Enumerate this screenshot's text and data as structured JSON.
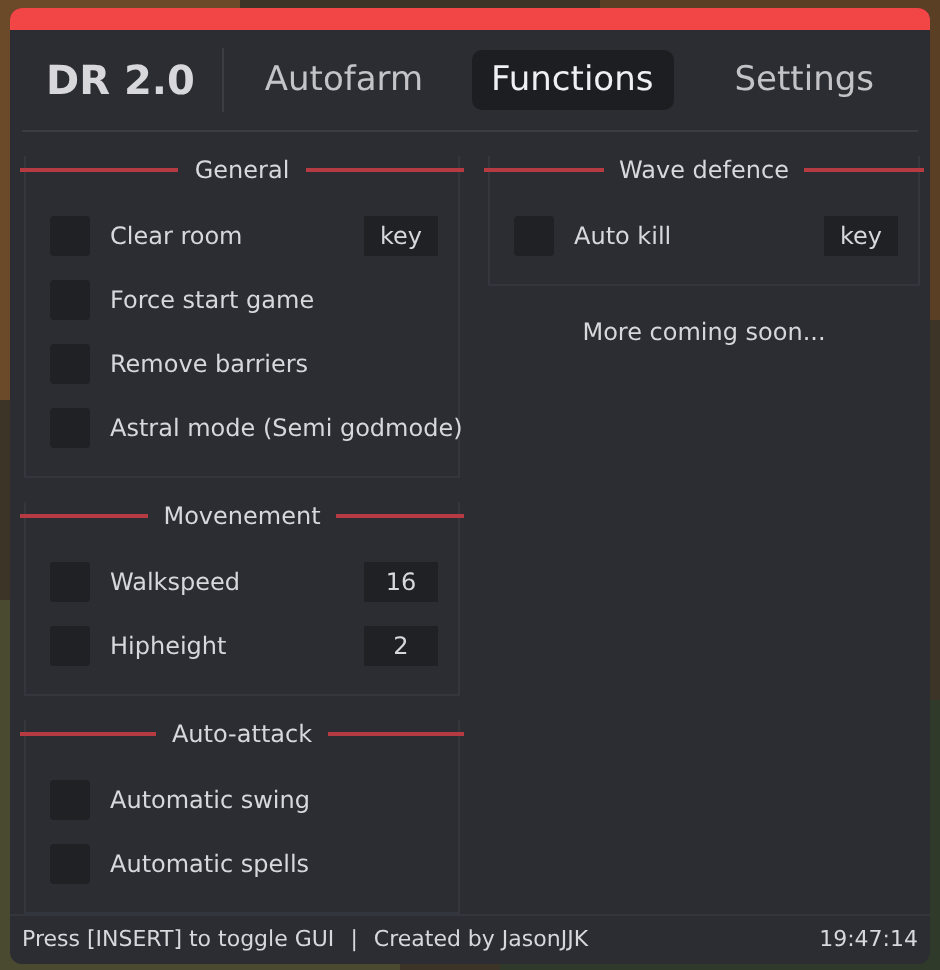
{
  "window": {
    "logo": "DR 2.0"
  },
  "tabs": [
    {
      "label": "Autofarm",
      "selected": false
    },
    {
      "label": "Functions",
      "selected": true
    },
    {
      "label": "Settings",
      "selected": false
    }
  ],
  "columns": [
    {
      "sections": [
        {
          "title": "General",
          "rows": [
            {
              "label": "Clear room",
              "checked": false,
              "kind": "keybind",
              "value": "key"
            },
            {
              "label": "Force start game",
              "checked": false,
              "kind": "toggle"
            },
            {
              "label": "Remove barriers",
              "checked": false,
              "kind": "toggle"
            },
            {
              "label": "Astral mode (Semi godmode)",
              "checked": false,
              "kind": "toggle"
            }
          ]
        },
        {
          "title": "Movenement",
          "rows": [
            {
              "label": "Walkspeed",
              "checked": false,
              "kind": "number",
              "value": "16"
            },
            {
              "label": "Hipheight",
              "checked": false,
              "kind": "number",
              "value": "2"
            }
          ]
        },
        {
          "title": "Auto-attack",
          "rows": [
            {
              "label": "Automatic swing",
              "checked": false,
              "kind": "toggle"
            },
            {
              "label": "Automatic spells",
              "checked": false,
              "kind": "toggle"
            }
          ]
        }
      ]
    },
    {
      "sections": [
        {
          "title": "Wave defence",
          "rows": [
            {
              "label": "Auto kill",
              "checked": false,
              "kind": "keybind",
              "value": "key"
            }
          ]
        }
      ],
      "note": "More coming soon..."
    }
  ],
  "status_bar": {
    "hint": "Press [INSERT] to toggle GUI",
    "separator": "|",
    "credit": "Created by JasonJJK",
    "time": "19:47:14"
  }
}
